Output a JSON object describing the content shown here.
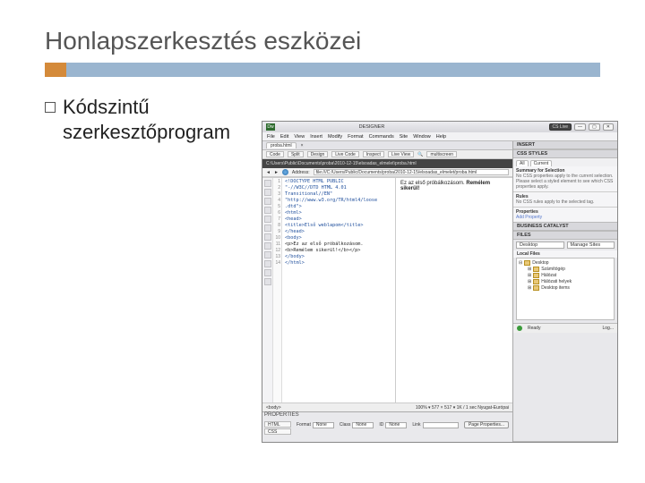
{
  "slide": {
    "title": "Honlapszerkesztés eszközei",
    "bullet": "Kódszintű szerkesztőprogram"
  },
  "dw": {
    "logo": "Dw",
    "titlebar": {
      "center": "DESIGNER",
      "cslive": "CS Live",
      "min": "—",
      "max": "▢",
      "close": "✕"
    },
    "menu": [
      "File",
      "Edit",
      "View",
      "Insert",
      "Modify",
      "Format",
      "Commands",
      "Site",
      "Window",
      "Help"
    ],
    "doc_tab": "proba.html",
    "viewbar": {
      "code": "Code",
      "split": "Split",
      "design": "Design",
      "live_code": "Live Code",
      "inspect": "Inspect",
      "live_view": "Live View",
      "search_icon": "🔍",
      "multiscreen": "multiscreen"
    },
    "pathbar": "C:\\Users\\Public\\Documents\\proba\\2010-12-15\\elsoadas_elmelet\\proba.html",
    "addressbar": {
      "label": "Address:",
      "value": "file:///C:/Users/Public/Documents/proba/2010-12-15/elsoadas_elmelet/proba.html"
    },
    "code_lines": [
      "<!DOCTYPE HTML PUBLIC",
      "\"-//W3C//DTD HTML 4.01",
      "Transitional//EN\"",
      "\"http://www.w3.org/TR/html4/loose",
      ".dtd\">",
      "<html>",
      "<head>",
      "<title>Első weblapom</title>",
      "</head>",
      "<body>",
      "<p>Ez az első próbálkozásom.",
      "<b>Remélem sikerül!</b></p>",
      "</body>",
      "</html>"
    ],
    "preview": {
      "line1_a": "Ez az első próbálkozásom. ",
      "line1_b": "Remélem",
      "line2": "sikerül!"
    },
    "status": {
      "left": "<body>",
      "right": "100%  ▾  577 × 517 ▾  1K / 1 sec  Nyugat-Európai"
    },
    "properties": {
      "title": "PROPERTIES",
      "tabs": {
        "html": "HTML",
        "css": "CSS"
      },
      "format": {
        "label": "Format",
        "value": "None"
      },
      "id": {
        "label": "ID",
        "value": "None"
      },
      "class": {
        "label": "Class",
        "value": "None"
      },
      "link": {
        "label": "Link",
        "value": ""
      },
      "button": "Page Properties..."
    },
    "panels": {
      "insert": "INSERT",
      "css_title": "CSS STYLES",
      "css_tabs": {
        "all": "All",
        "current": "Current"
      },
      "css_summary_h": "Summary for Selection",
      "css_summary": "No CSS properties apply to the current selection. Please select a styled element to see which CSS properties apply.",
      "css_rules_h": "Rules",
      "css_rules": "No CSS rules apply to the selected tag.",
      "css_props_h": "Properties",
      "css_addprop": "Add Property",
      "bc_title": "BUSINESS CATALYST",
      "files_title": "FILES",
      "files_site": "Desktop",
      "files_manage": "Manage Sites",
      "files_local": "Local Files",
      "tree": {
        "root": "Desktop",
        "items": [
          "Számítógép",
          "Hálózat",
          "Hálózati helyek",
          "Desktop items"
        ]
      },
      "log": {
        "ready": "Ready",
        "log": "Log..."
      }
    }
  }
}
